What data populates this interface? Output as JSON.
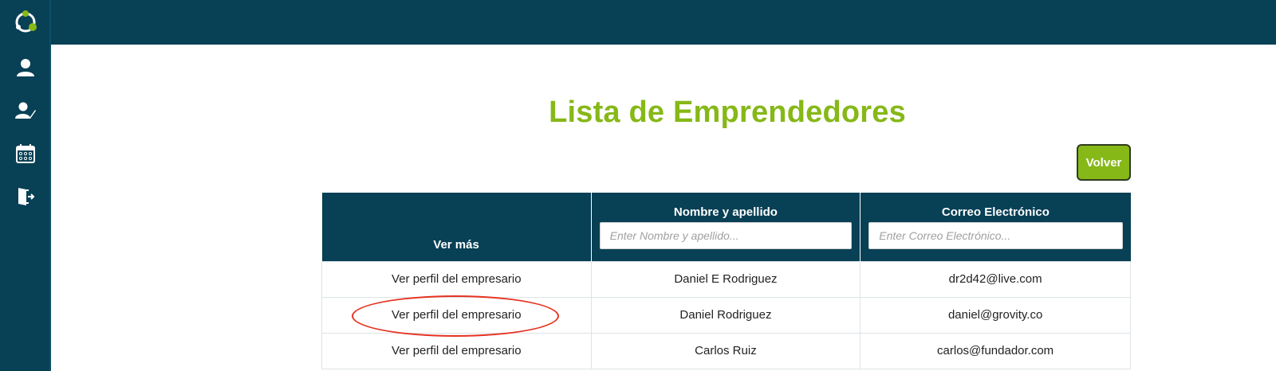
{
  "page": {
    "title": "Lista de Emprendedores",
    "back_button": "Volver"
  },
  "sidebar": {
    "items": [
      {
        "icon": "user-icon"
      },
      {
        "icon": "user-edit-icon"
      },
      {
        "icon": "calendar-icon"
      },
      {
        "icon": "logout-door-icon"
      }
    ]
  },
  "table": {
    "headers": {
      "ver_mas": "Ver más",
      "name": "Nombre y apellido",
      "email": "Correo Electrónico"
    },
    "filters": {
      "name_placeholder": "Enter Nombre y apellido...",
      "email_placeholder": "Enter Correo Electrónico..."
    },
    "rows": [
      {
        "link": "Ver perfil del empresario",
        "name": "Daniel E Rodriguez",
        "email": "dr2d42@live.com"
      },
      {
        "link": "Ver perfil del empresario",
        "name": "Daniel Rodriguez",
        "email": "daniel@grovity.co"
      },
      {
        "link": "Ver perfil del empresario",
        "name": "Carlos Ruiz",
        "email": "carlos@fundador.com"
      }
    ]
  },
  "colors": {
    "navy": "#084055",
    "green": "#86b817",
    "highlight": "#e63322"
  }
}
